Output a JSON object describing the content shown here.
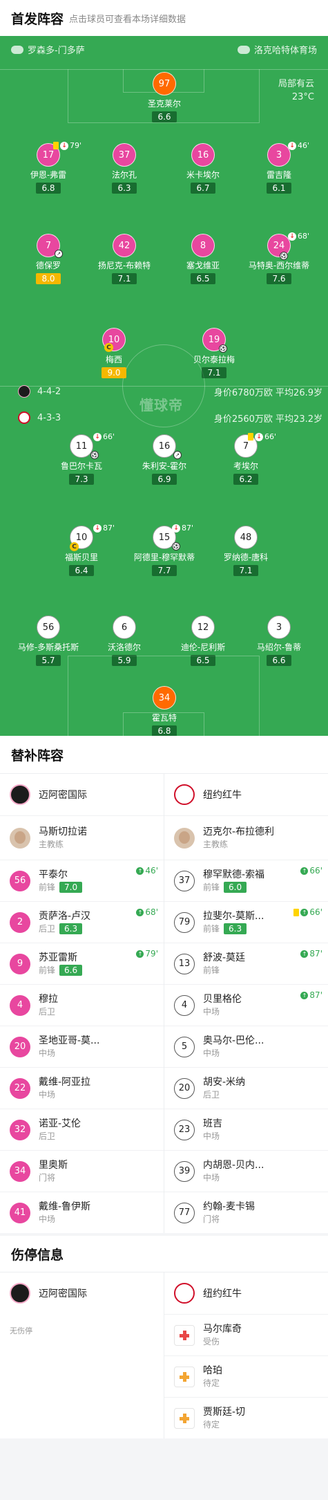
{
  "starting": {
    "title": "首发阵容",
    "subtitle": "点击球员可查看本场详细数据"
  },
  "pitch": {
    "home_stadium_team": "罗森多-门多萨",
    "away_stadium_team": "洛克哈特体育场",
    "weather": "局部有云",
    "temperature": "23°C",
    "watermark": "懂球帝",
    "home_formation": "4-4-2",
    "home_value": "身价6780万欧 平均26.9岁",
    "away_formation": "4-3-3",
    "away_value": "身价2560万欧 平均23.2岁"
  },
  "home_players": [
    {
      "num": "97",
      "name": "圣克莱尔",
      "rating": "6.6"
    },
    {
      "num": "17",
      "name": "伊恩-弗雷",
      "rating": "6.8",
      "event": "79'"
    },
    {
      "num": "37",
      "name": "法尔孔",
      "rating": "6.3"
    },
    {
      "num": "16",
      "name": "米卡埃尔",
      "rating": "6.7"
    },
    {
      "num": "3",
      "name": "雷吉隆",
      "rating": "6.1",
      "event": "46'"
    },
    {
      "num": "7",
      "name": "德保罗",
      "rating": "8.0"
    },
    {
      "num": "42",
      "name": "扬尼克-布赖特",
      "rating": "7.1"
    },
    {
      "num": "8",
      "name": "塞戈维亚",
      "rating": "6.5"
    },
    {
      "num": "24",
      "name": "马特奥-西尔维蒂",
      "rating": "7.6",
      "event": "68'"
    },
    {
      "num": "10",
      "name": "梅西",
      "rating": "9.0"
    },
    {
      "num": "19",
      "name": "贝尔泰拉梅",
      "rating": "7.1"
    }
  ],
  "away_players": [
    {
      "num": "11",
      "name": "鲁巴尔卡瓦",
      "rating": "7.3",
      "event": "66'"
    },
    {
      "num": "16",
      "name": "朱利安-霍尔",
      "rating": "6.9"
    },
    {
      "num": "7",
      "name": "考埃尔",
      "rating": "6.2",
      "event": "66'"
    },
    {
      "num": "10",
      "name": "福斯贝里",
      "rating": "6.4",
      "event": "87'"
    },
    {
      "num": "15",
      "name": "阿德里-穆罕默蒂",
      "rating": "7.7",
      "event": "87'"
    },
    {
      "num": "48",
      "name": "罗纳德-唐科",
      "rating": "7.1"
    },
    {
      "num": "56",
      "name": "马修-多斯桑托斯",
      "rating": "5.7"
    },
    {
      "num": "6",
      "name": "沃洛德尔",
      "rating": "5.9"
    },
    {
      "num": "12",
      "name": "迪伦-尼利斯",
      "rating": "6.5"
    },
    {
      "num": "3",
      "name": "马绍尔-鲁蒂",
      "rating": "6.6"
    },
    {
      "num": "34",
      "name": "霍瓦特",
      "rating": "6.8"
    }
  ],
  "bench": {
    "title": "替补阵容",
    "home_team": "迈阿密国际",
    "away_team": "纽约红牛",
    "home_coach": {
      "name": "马斯切拉诺",
      "role": "主教练"
    },
    "away_coach": {
      "name": "迈克尔-布拉德利",
      "role": "主教练"
    },
    "home": [
      {
        "num": "56",
        "name": "平泰尔",
        "pos": "前锋",
        "rating": "7.0",
        "sub": "46'"
      },
      {
        "num": "2",
        "name": "贡萨洛-卢汉",
        "pos": "后卫",
        "rating": "6.3",
        "sub": "68'"
      },
      {
        "num": "9",
        "name": "苏亚雷斯",
        "pos": "前锋",
        "rating": "6.6",
        "sub": "79'"
      },
      {
        "num": "4",
        "name": "穆拉",
        "pos": "后卫"
      },
      {
        "num": "20",
        "name": "圣地亚哥-莫...",
        "pos": "中场"
      },
      {
        "num": "22",
        "name": "戴维-阿亚拉",
        "pos": "中场"
      },
      {
        "num": "32",
        "name": "诺亚-艾伦",
        "pos": "后卫"
      },
      {
        "num": "34",
        "name": "里奥斯",
        "pos": "门将"
      },
      {
        "num": "41",
        "name": "戴维-鲁伊斯",
        "pos": "中场"
      }
    ],
    "away": [
      {
        "num": "37",
        "name": "穆罕默德-索福",
        "pos": "前锋",
        "rating": "6.0",
        "sub": "66'"
      },
      {
        "num": "79",
        "name": "拉斐尔-莫斯...",
        "pos": "前锋",
        "rating": "6.3",
        "sub": "66'"
      },
      {
        "num": "13",
        "name": "舒波-莫廷",
        "pos": "前锋",
        "sub": "87'"
      },
      {
        "num": "4",
        "name": "贝里格伦",
        "pos": "中场",
        "sub": "87'"
      },
      {
        "num": "5",
        "name": "奥马尔-巴伦...",
        "pos": "中场"
      },
      {
        "num": "20",
        "name": "胡安-米纳",
        "pos": "后卫"
      },
      {
        "num": "23",
        "name": "班吉",
        "pos": "中场"
      },
      {
        "num": "39",
        "name": "内胡恩-贝内...",
        "pos": "中场"
      },
      {
        "num": "77",
        "name": "约翰-麦卡锡",
        "pos": "门将"
      }
    ]
  },
  "injury": {
    "title": "伤停信息",
    "home_team": "迈阿密国际",
    "away_team": "纽约红牛",
    "home_none": "无伤停",
    "away": [
      {
        "name": "马尔库奇",
        "status": "受伤"
      },
      {
        "name": "哈珀",
        "status": "待定"
      },
      {
        "name": "贾斯廷-切",
        "status": "待定"
      }
    ]
  }
}
